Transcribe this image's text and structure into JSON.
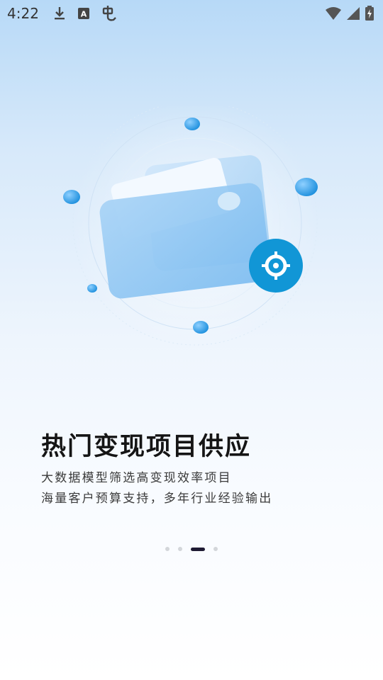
{
  "status_bar": {
    "time": "4:22",
    "left_icons": [
      "download-icon",
      "text-a-icon",
      "bug-icon"
    ],
    "right_icons": [
      "wifi-icon",
      "signal-icon",
      "battery-icon"
    ]
  },
  "onboarding": {
    "headline": "热门变现项目供应",
    "description_line1": "大数据模型筛选高变现效率项目",
    "description_line2": "海量客户预算支持，多年行业经验输出"
  },
  "pager": {
    "total": 4,
    "active_index": 2
  },
  "colors": {
    "accent": "#1196d6",
    "pager_active": "#1e1a33",
    "pager_inactive": "#d3d6da"
  }
}
